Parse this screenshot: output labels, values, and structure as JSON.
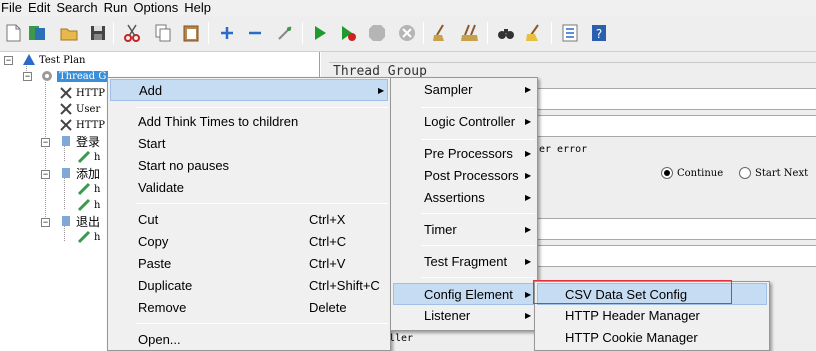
{
  "menubar": {
    "items": [
      "File",
      "Edit",
      "Search",
      "Run",
      "Options",
      "Help"
    ]
  },
  "toolbar": {
    "icons": [
      "new-file-icon",
      "templates-icon",
      "open-icon",
      "save-icon",
      "cut-icon",
      "copy-icon",
      "paste-icon",
      "expand-icon",
      "collapse-icon",
      "toggle-icon",
      "start-icon",
      "start-no-pauses-icon",
      "stop-icon",
      "shutdown-icon",
      "clear-icon",
      "clear-all-icon",
      "search-icon",
      "reset-search-icon",
      "function-helper-icon",
      "help-icon"
    ]
  },
  "tree": {
    "test_plan": "Test Plan",
    "thread_group": "Thread G",
    "children": [
      {
        "label": "HTTP",
        "type": "config"
      },
      {
        "label": "User",
        "type": "config"
      },
      {
        "label": "HTTP",
        "type": "config"
      },
      {
        "label": "登录",
        "type": "controller"
      },
      {
        "label": "h",
        "type": "sampler"
      },
      {
        "label": "添加",
        "type": "controller"
      },
      {
        "label": "h",
        "type": "sampler"
      },
      {
        "label": "h",
        "type": "sampler"
      },
      {
        "label": "退出",
        "type": "controller"
      },
      {
        "label": "h",
        "type": "sampler"
      }
    ]
  },
  "panel": {
    "title": "Thread Group",
    "error_label": "er error",
    "radio_continue": "Continue",
    "radio_start_next": "Start Next",
    "controller_label": "ller"
  },
  "context_menu": {
    "items": [
      {
        "label": "Add",
        "shortcut": "",
        "submenu": true,
        "highlighted": true
      },
      {
        "label": "Add Think Times to children",
        "shortcut": ""
      },
      {
        "label": "Start",
        "shortcut": ""
      },
      {
        "label": "Start no pauses",
        "shortcut": ""
      },
      {
        "label": "Validate",
        "shortcut": ""
      },
      {
        "label": "Cut",
        "shortcut": "Ctrl+X"
      },
      {
        "label": "Copy",
        "shortcut": "Ctrl+C"
      },
      {
        "label": "Paste",
        "shortcut": "Ctrl+V"
      },
      {
        "label": "Duplicate",
        "shortcut": "Ctrl+Shift+C"
      },
      {
        "label": "Remove",
        "shortcut": "Delete"
      },
      {
        "label": "Open...",
        "shortcut": ""
      }
    ]
  },
  "add_submenu": {
    "items": [
      {
        "label": "Sampler",
        "submenu": true
      },
      {
        "label": "Logic Controller",
        "submenu": true
      },
      {
        "label": "Pre Processors",
        "submenu": true
      },
      {
        "label": "Post Processors",
        "submenu": true
      },
      {
        "label": "Assertions",
        "submenu": true
      },
      {
        "label": "Timer",
        "submenu": true
      },
      {
        "label": "Test Fragment",
        "submenu": true
      },
      {
        "label": "Config Element",
        "submenu": true,
        "highlighted": true
      },
      {
        "label": "Listener",
        "submenu": true
      }
    ]
  },
  "config_submenu": {
    "items": [
      {
        "label": "CSV Data Set Config",
        "highlighted": true,
        "outlined": true
      },
      {
        "label": "HTTP Header Manager"
      },
      {
        "label": "HTTP Cookie Manager"
      }
    ]
  },
  "colors": {
    "selection": "#3a8fd9",
    "menu_highlight": "#c6dcf2",
    "outline": "#e0333a"
  }
}
